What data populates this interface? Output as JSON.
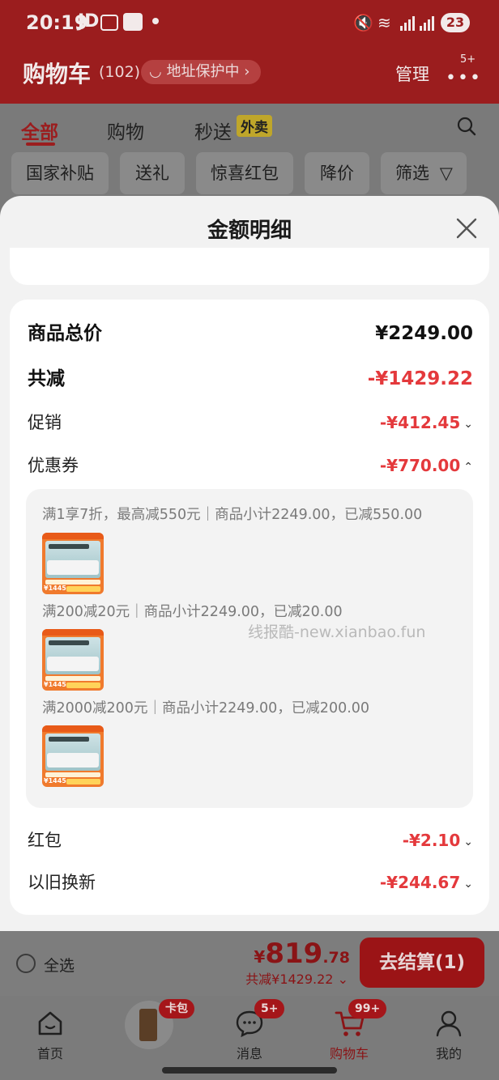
{
  "status_bar": {
    "time": "20:19",
    "carrier": "JD",
    "battery": "23"
  },
  "header": {
    "title": "购物车",
    "count": "(102)",
    "address_protect": "地址保护中",
    "manage": "管理",
    "more_badge": "5+"
  },
  "cart_tabs": [
    {
      "label": "全部",
      "active": true
    },
    {
      "label": "购物",
      "active": false
    },
    {
      "label": "秒送",
      "active": false
    }
  ],
  "cart_tab_tag": "外卖",
  "filters": [
    "国家补贴",
    "送礼",
    "惊喜红包",
    "降价",
    "筛选"
  ],
  "sheet": {
    "title": "金额明细",
    "rows": {
      "goods_total": {
        "label": "商品总价",
        "value": "¥2249.00"
      },
      "total_reduce": {
        "label": "共减",
        "value": "-¥1429.22"
      },
      "promotion": {
        "label": "促销",
        "value": "-¥412.45"
      },
      "coupon": {
        "label": "优惠券",
        "value": "-¥770.00"
      },
      "red_packet": {
        "label": "红包",
        "value": "-¥2.10"
      },
      "trade_in": {
        "label": "以旧换新",
        "value": "-¥244.67"
      }
    },
    "coupon_details": [
      {
        "text": "满1享7折，最高减550元｜商品小计2249.00，已减550.00",
        "thumb_price": "¥1445"
      },
      {
        "text": "满200减20元｜商品小计2249.00，已减20.00",
        "thumb_price": "¥1445"
      },
      {
        "text": "满2000减200元｜商品小计2249.00，已减200.00",
        "thumb_price": "¥1445"
      }
    ],
    "watermark": "线报酷-new.xianbao.fun"
  },
  "checkout": {
    "select_all": "全选",
    "price_symbol": "¥",
    "price_int": "819",
    "price_dec": ".78",
    "reduce_text": "共减¥1429.22",
    "button": "去结算(1)"
  },
  "tabbar": [
    {
      "label": "首页",
      "icon": "home-icon"
    },
    {
      "label": "",
      "icon": "card-wallet-icon",
      "badge": "卡包"
    },
    {
      "label": "消息",
      "icon": "message-icon",
      "badge": "5+"
    },
    {
      "label": "购物车",
      "icon": "cart-icon",
      "badge": "99+"
    },
    {
      "label": "我的",
      "icon": "user-icon"
    }
  ],
  "colors": {
    "brand_red": "#e4393c",
    "header_dim": "#9b1d1e",
    "sheet_bg": "#f2f2f2"
  }
}
